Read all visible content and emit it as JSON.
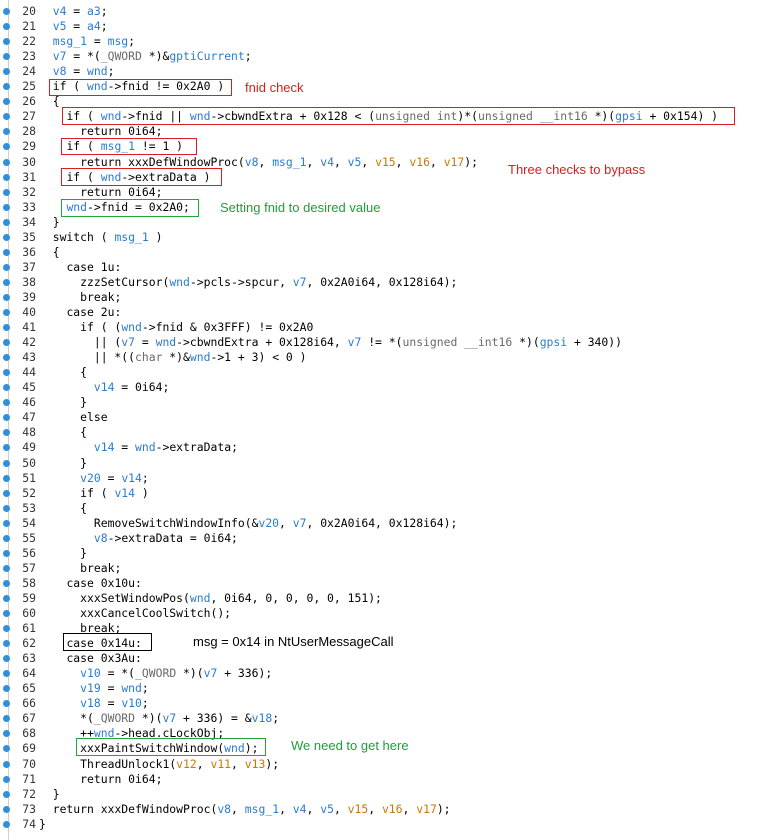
{
  "lines": [
    {
      "n": "20",
      "t": "  v4 = a3;"
    },
    {
      "n": "21",
      "t": "  v5 = a4;"
    },
    {
      "n": "22",
      "t": "  msg_1 = msg;"
    },
    {
      "n": "23",
      "t": "  v7 = *(_QWORD *)&gptiCurrent;"
    },
    {
      "n": "24",
      "t": "  v8 = wnd;"
    },
    {
      "n": "25",
      "t": "  if ( wnd->fnid != 0x2A0 )"
    },
    {
      "n": "26",
      "t": "  {"
    },
    {
      "n": "27",
      "t": "    if ( wnd->fnid || wnd->cbwndExtra + 0x128 < (unsigned int)*(unsigned __int16 *)(gpsi + 0x154) )"
    },
    {
      "n": "28",
      "t": "      return 0i64;"
    },
    {
      "n": "29",
      "t": "    if ( msg_1 != 1 )"
    },
    {
      "n": "30",
      "t": "      return xxxDefWindowProc(v8, msg_1, v4, v5, v15, v16, v17);"
    },
    {
      "n": "31",
      "t": "    if ( wnd->extraData )"
    },
    {
      "n": "32",
      "t": "      return 0i64;"
    },
    {
      "n": "33",
      "t": "    wnd->fnid = 0x2A0;"
    },
    {
      "n": "34",
      "t": "  }"
    },
    {
      "n": "35",
      "t": "  switch ( msg_1 )"
    },
    {
      "n": "36",
      "t": "  {"
    },
    {
      "n": "37",
      "t": "    case 1u:"
    },
    {
      "n": "38",
      "t": "      zzzSetCursor(wnd->pcls->spcur, v7, 0x2A0i64, 0x128i64);"
    },
    {
      "n": "39",
      "t": "      break;"
    },
    {
      "n": "40",
      "t": "    case 2u:"
    },
    {
      "n": "41",
      "t": "      if ( (wnd->fnid & 0x3FFF) != 0x2A0"
    },
    {
      "n": "42",
      "t": "        || (v7 = wnd->cbwndExtra + 0x128i64, v7 != *(unsigned __int16 *)(gpsi + 340))"
    },
    {
      "n": "43",
      "t": "        || *((char *)&wnd->1 + 3) < 0 )"
    },
    {
      "n": "44",
      "t": "      {"
    },
    {
      "n": "45",
      "t": "        v14 = 0i64;"
    },
    {
      "n": "46",
      "t": "      }"
    },
    {
      "n": "47",
      "t": "      else"
    },
    {
      "n": "48",
      "t": "      {"
    },
    {
      "n": "49",
      "t": "        v14 = wnd->extraData;"
    },
    {
      "n": "50",
      "t": "      }"
    },
    {
      "n": "51",
      "t": "      v20 = v14;"
    },
    {
      "n": "52",
      "t": "      if ( v14 )"
    },
    {
      "n": "53",
      "t": "      {"
    },
    {
      "n": "54",
      "t": "        RemoveSwitchWindowInfo(&v20, v7, 0x2A0i64, 0x128i64);"
    },
    {
      "n": "55",
      "t": "        v8->extraData = 0i64;"
    },
    {
      "n": "56",
      "t": "      }"
    },
    {
      "n": "57",
      "t": "      break;"
    },
    {
      "n": "58",
      "t": "    case 0x10u:"
    },
    {
      "n": "59",
      "t": "      xxxSetWindowPos(wnd, 0i64, 0, 0, 0, 0, 151);"
    },
    {
      "n": "60",
      "t": "      xxxCancelCoolSwitch();"
    },
    {
      "n": "61",
      "t": "      break;"
    },
    {
      "n": "62",
      "t": "    case 0x14u:"
    },
    {
      "n": "63",
      "t": "    case 0x3Au:"
    },
    {
      "n": "64",
      "t": "      v10 = *(_QWORD *)(v7 + 336);"
    },
    {
      "n": "65",
      "t": "      v19 = wnd;"
    },
    {
      "n": "66",
      "t": "      v18 = v10;"
    },
    {
      "n": "67",
      "t": "      *(_QWORD *)(v7 + 336) = &v18;"
    },
    {
      "n": "68",
      "t": "      ++wnd->head.cLockObj;"
    },
    {
      "n": "69",
      "t": "      xxxPaintSwitchWindow(wnd);"
    },
    {
      "n": "70",
      "t": "      ThreadUnlock1(v12, v11, v13);"
    },
    {
      "n": "71",
      "t": "      return 0i64;"
    },
    {
      "n": "72",
      "t": "  }"
    },
    {
      "n": "73",
      "t": "  return xxxDefWindowProc(v8, msg_1, v4, v5, v15, v16, v17);"
    },
    {
      "n": "74",
      "t": "}"
    }
  ],
  "annotations": {
    "fnid_check": "fnid check",
    "three_checks": "Three checks to bypass",
    "setting_fnid": "Setting fnid to desired value",
    "msg_note": "msg = 0x14 in NtUserMessageCall",
    "get_here": "We need to get here"
  },
  "colors": {
    "breakpoint": "#2f8fd8",
    "annotation_red": "#d81e1e",
    "annotation_green": "#1f9e3a",
    "variable": "#2b7bd1",
    "argument": "#c77a00"
  }
}
